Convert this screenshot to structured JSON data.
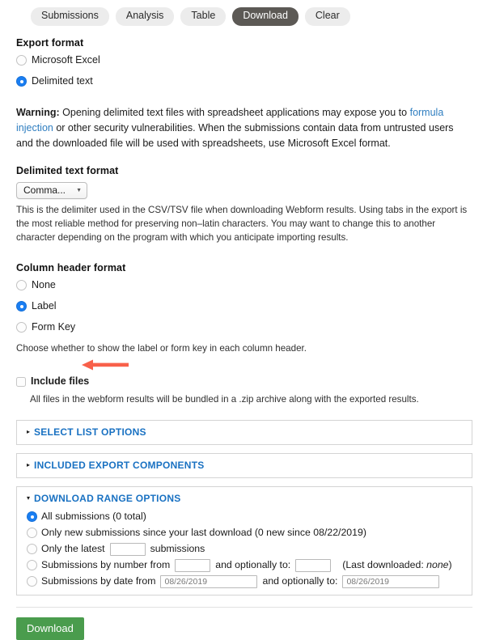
{
  "tabs": [
    {
      "label": "Submissions",
      "active": false
    },
    {
      "label": "Analysis",
      "active": false
    },
    {
      "label": "Table",
      "active": false
    },
    {
      "label": "Download",
      "active": true
    },
    {
      "label": "Clear",
      "active": false
    }
  ],
  "export_format": {
    "title": "Export format",
    "options": [
      {
        "label": "Microsoft Excel",
        "selected": false
      },
      {
        "label": "Delimited text",
        "selected": true
      }
    ]
  },
  "warning": {
    "prefix": "Warning:",
    "text_1": " Opening delimited text files with spreadsheet applications may expose you to ",
    "link": "formula injection",
    "text_2": " or other security vulnerabilities. When the submissions contain data from untrusted users and the downloaded file will be used with spreadsheets, use Microsoft Excel format."
  },
  "delimited_format": {
    "title": "Delimited text format",
    "select_value": "Comma...",
    "caret_icon": "chevron-down-icon",
    "description": "This is the delimiter used in the CSV/TSV file when downloading Webform results. Using tabs in the export is the most reliable method for preserving non–latin characters. You may want to change this to another character depending on the program with which you anticipate importing results."
  },
  "column_header_format": {
    "title": "Column header format",
    "options": [
      {
        "label": "None",
        "selected": false
      },
      {
        "label": "Label",
        "selected": true
      },
      {
        "label": "Form Key",
        "selected": false
      }
    ],
    "description": "Choose whether to show the label or form key in each column header."
  },
  "include_files": {
    "label": "Include files",
    "checked": false,
    "description": "All files in the webform results will be bundled in a .zip archive along with the exported results."
  },
  "panels": [
    {
      "title": "SELECT LIST OPTIONS",
      "expanded": false,
      "marker": "▸"
    },
    {
      "title": "INCLUDED EXPORT COMPONENTS",
      "expanded": false,
      "marker": "▸"
    },
    {
      "title": "DOWNLOAD RANGE OPTIONS",
      "expanded": true,
      "marker": "▾"
    }
  ],
  "download_range": {
    "all": {
      "label": "All submissions (0 total)",
      "selected": true
    },
    "new": {
      "label": "Only new submissions since your last download (0 new since 08/22/2019)",
      "selected": false
    },
    "latest": {
      "prefix": "Only the latest",
      "suffix": "submissions",
      "value": "",
      "selected": false
    },
    "by_number": {
      "prefix": "Submissions by number from",
      "middle": "and optionally to:",
      "note": "(Last downloaded: ",
      "note_italic": "none",
      "note_end": ")",
      "from_value": "",
      "to_value": "",
      "selected": false
    },
    "by_date": {
      "prefix": "Submissions by date from",
      "middle": "and optionally to:",
      "from_value": "08/26/2019",
      "to_value": "08/26/2019",
      "selected": false
    }
  },
  "submit": {
    "label": "Download"
  },
  "annotation": {
    "arrow_color": "#f8604a",
    "points_to": "include-files-checkbox"
  }
}
